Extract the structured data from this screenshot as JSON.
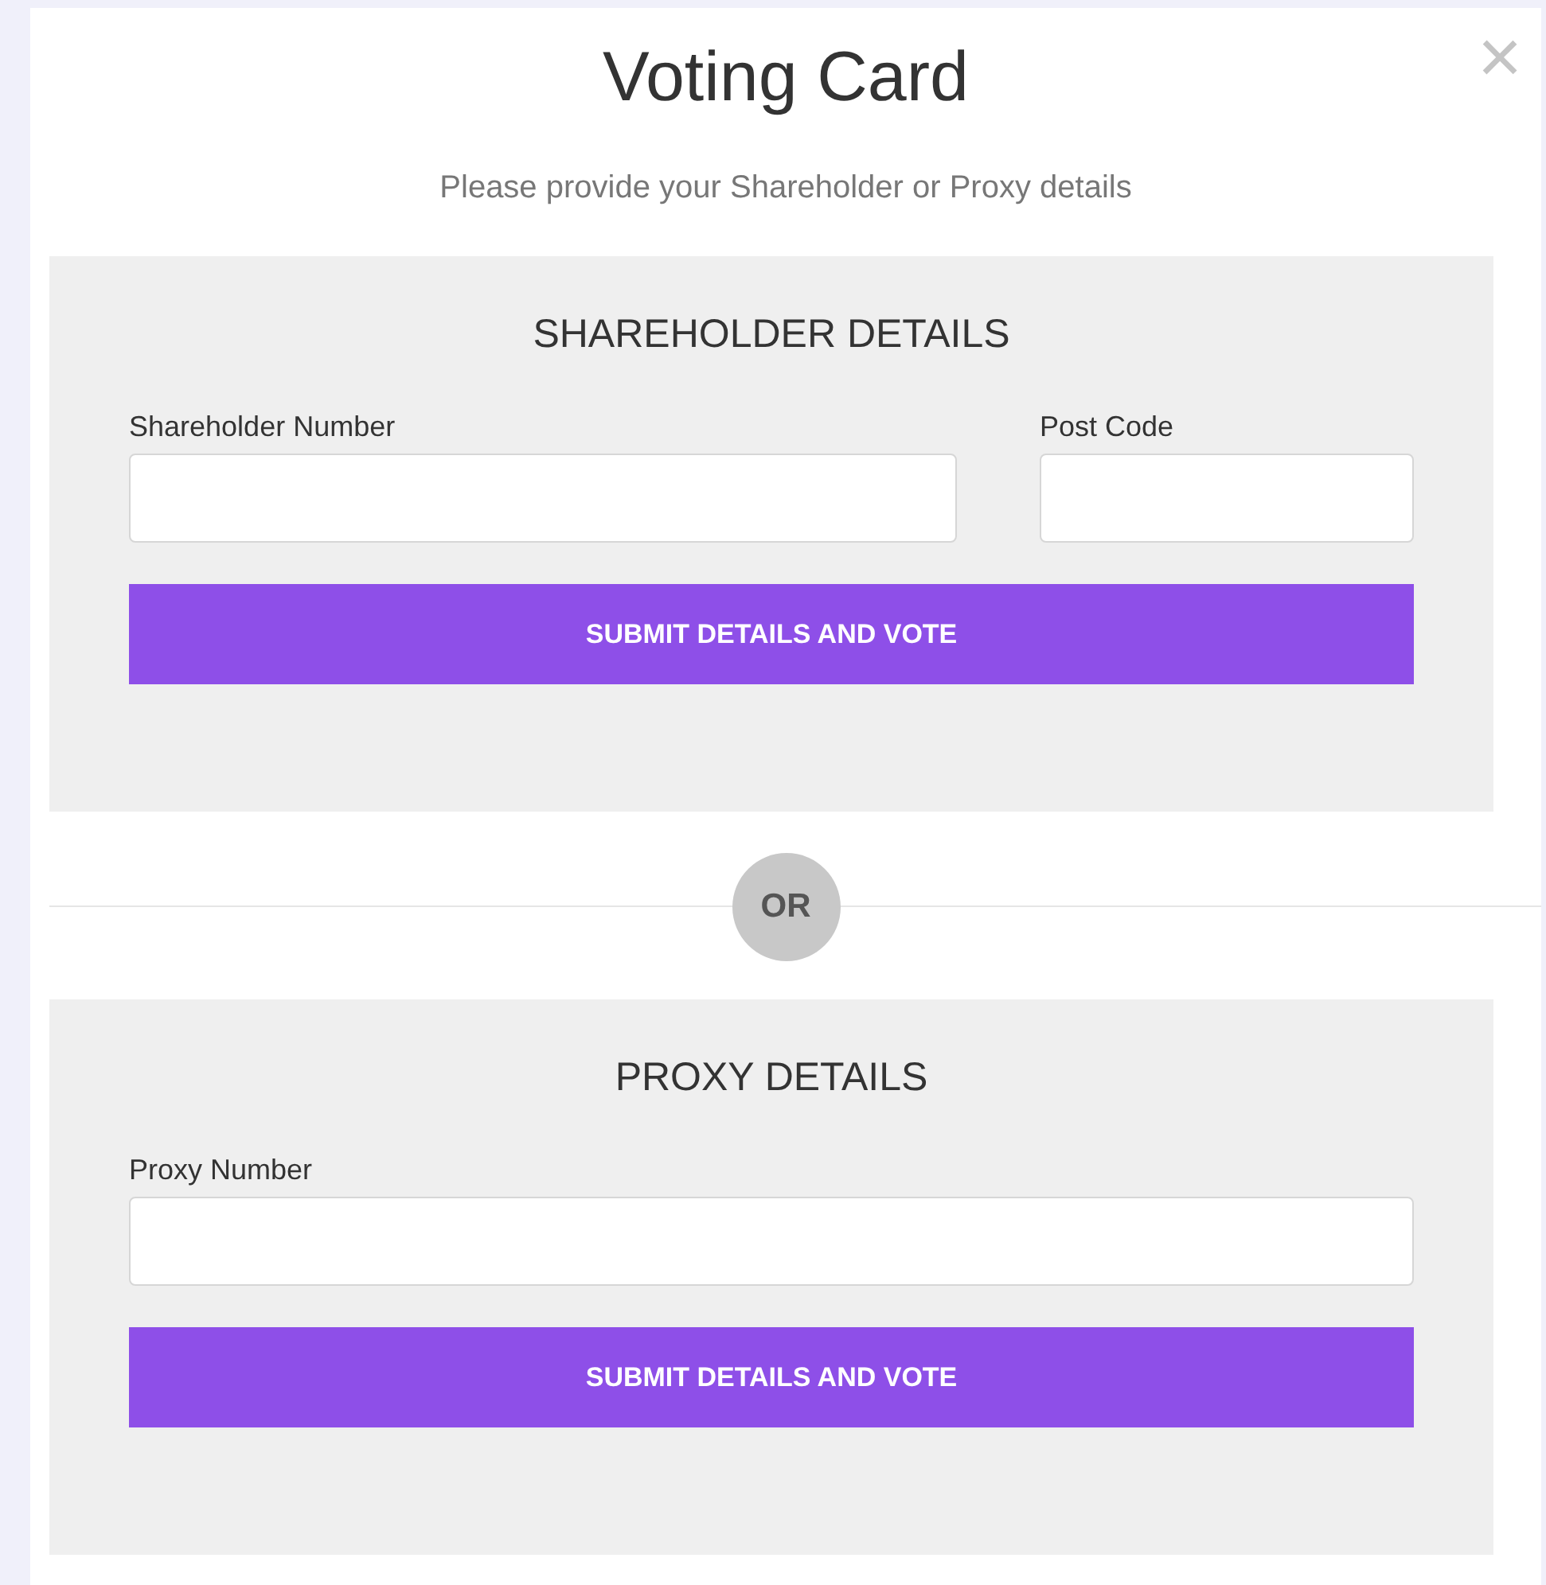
{
  "dialog": {
    "title": "Voting Card",
    "close": "×",
    "subtitle": "Please provide your Shareholder or Proxy details"
  },
  "sections": [
    {
      "heading": "SHAREHOLDER DETAILS",
      "fields": [
        {
          "label": "Shareholder Number"
        },
        {
          "label": "Post Code"
        }
      ],
      "button": "SUBMIT DETAILS AND VOTE"
    },
    {
      "heading": "PROXY DETAILS",
      "fields": [
        {
          "label": "Proxy Number"
        }
      ],
      "button": "SUBMIT DETAILS AND VOTE"
    }
  ],
  "separator": "OR"
}
